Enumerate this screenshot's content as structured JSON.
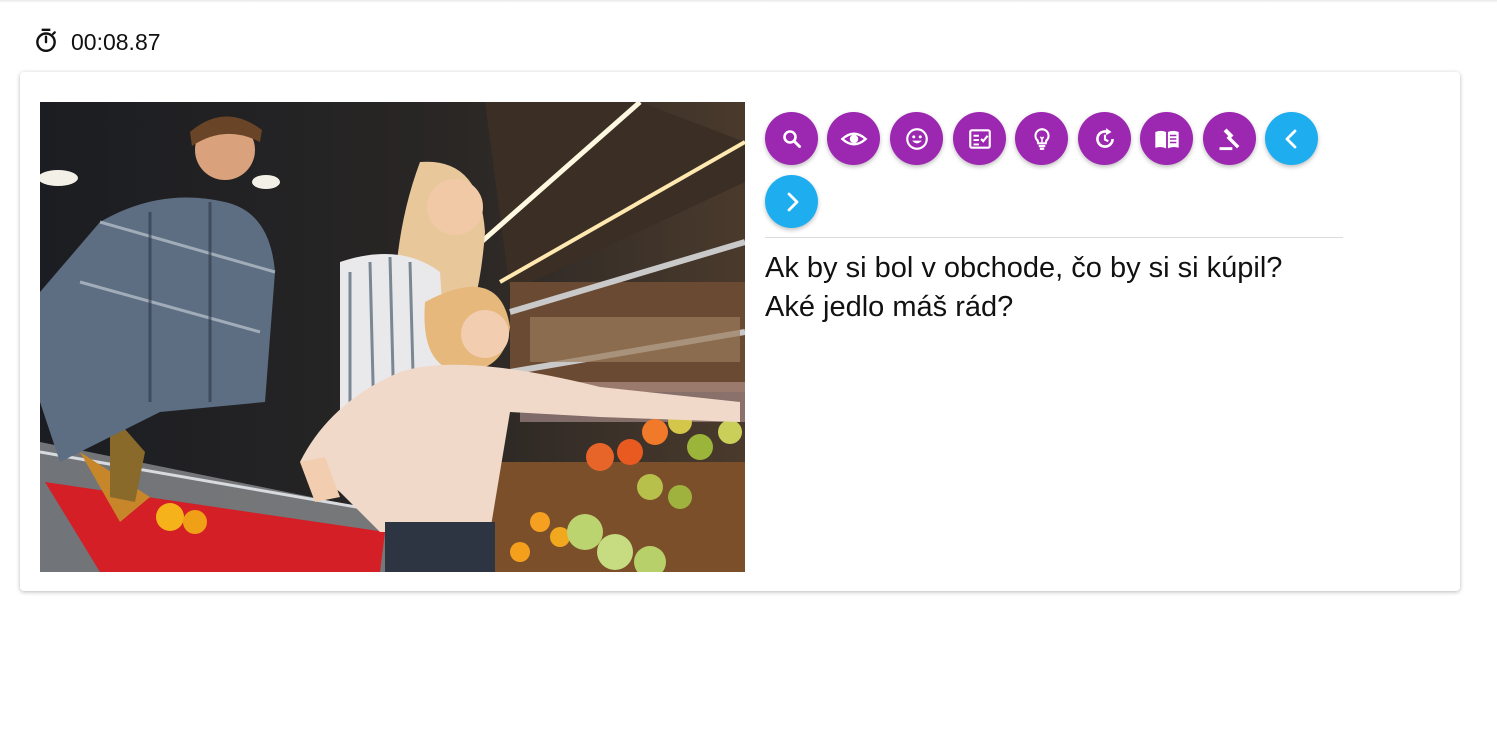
{
  "timer": {
    "value": "00:08.87",
    "icon": "stopwatch-icon"
  },
  "scene": {
    "description_icon": "photo"
  },
  "toolbar": {
    "buttons": [
      {
        "name": "search-button",
        "icon": "magnify-icon",
        "color": "#9c27b0"
      },
      {
        "name": "view-button",
        "icon": "eye-icon",
        "color": "#9c27b0"
      },
      {
        "name": "emotion-button",
        "icon": "smiley-icon",
        "color": "#9c27b0"
      },
      {
        "name": "checklist-button",
        "icon": "checklist-icon",
        "color": "#9c27b0"
      },
      {
        "name": "idea-button",
        "icon": "lightbulb-icon",
        "color": "#9c27b0"
      },
      {
        "name": "repeat-button",
        "icon": "refresh-icon",
        "color": "#9c27b0"
      },
      {
        "name": "book-button",
        "icon": "book-icon",
        "color": "#9c27b0"
      },
      {
        "name": "judge-button",
        "icon": "gavel-icon",
        "color": "#9c27b0"
      },
      {
        "name": "previous-button",
        "icon": "chevron-left-icon",
        "color": "#1eaef0"
      },
      {
        "name": "next-button",
        "icon": "chevron-right-icon",
        "color": "#1eaef0"
      }
    ]
  },
  "questions": [
    "Ak by si bol v obchode, čo by si si kúpil?",
    "Aké jedlo máš rád?"
  ]
}
